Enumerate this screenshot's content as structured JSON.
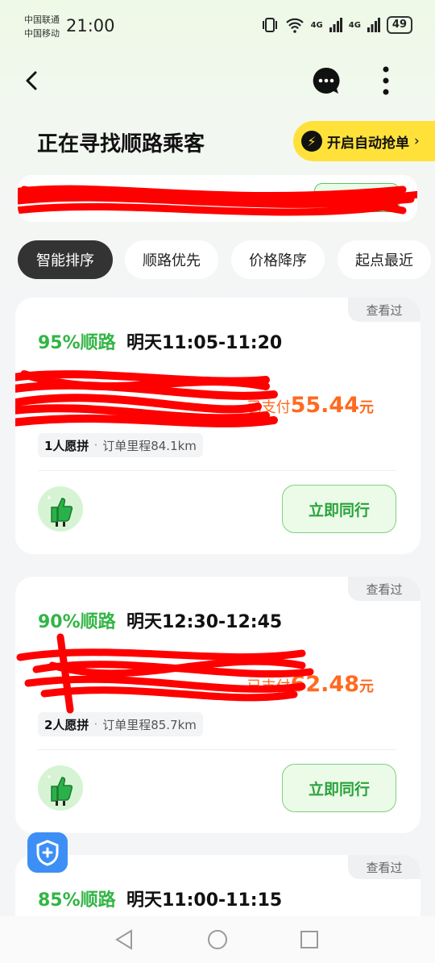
{
  "status_bar": {
    "carrier_1": "中国联通",
    "carrier_2": "中国移动",
    "time": "21:00",
    "signal_1": "4G",
    "signal_2": "4G",
    "battery": "49"
  },
  "header": {
    "title": "正在寻找顺路乘客",
    "auto_grab_label": "开启自动抢单",
    "auto_grab_chevron": "›"
  },
  "sort_chips": [
    {
      "label": "智能排序",
      "active": true
    },
    {
      "label": "顺路优先",
      "active": false
    },
    {
      "label": "价格降序",
      "active": false
    },
    {
      "label": "起点最近",
      "active": false
    }
  ],
  "orders": [
    {
      "viewed": "查看过",
      "match": "95%顺路",
      "time": "明天11:05-11:20",
      "paid_label": "已支付",
      "price": "55.44",
      "unit": "元",
      "seats": "1人愿拼",
      "distance": "订单里程84.1km",
      "action": "立即同行"
    },
    {
      "viewed": "查看过",
      "match": "90%顺路",
      "time": "明天12:30-12:45",
      "paid_label": "已支付",
      "price": "62.48",
      "unit": "元",
      "seats": "2人愿拼",
      "distance": "订单里程85.7km",
      "action": "立即同行"
    },
    {
      "viewed": "查看过",
      "match": "85%顺路",
      "time": "明天11:00-11:15"
    }
  ],
  "colors": {
    "accent_green": "#32b545",
    "price_orange": "#ff6a1f",
    "auto_grab_yellow": "#ffe13a",
    "redaction_red": "#ff0000"
  }
}
